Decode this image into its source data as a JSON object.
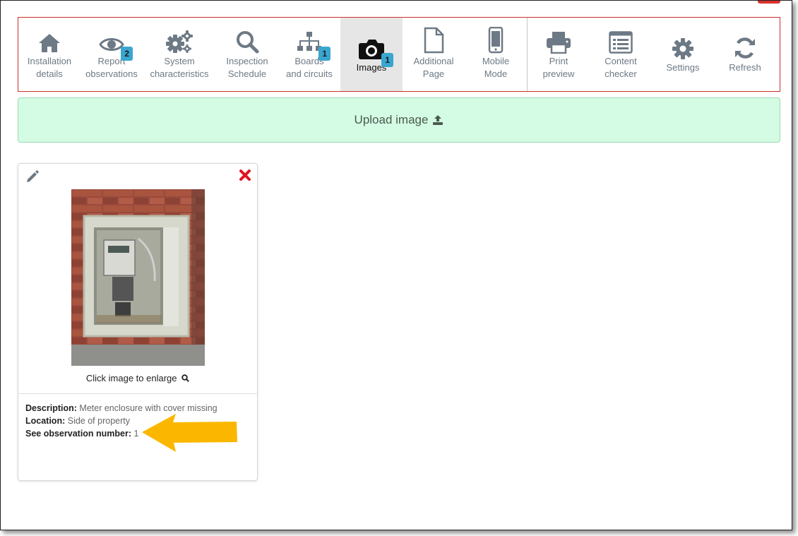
{
  "toolbar": {
    "items": [
      {
        "label": "Installation\ndetails",
        "icon": "home-icon"
      },
      {
        "label": "Report\nobservations",
        "icon": "eye-icon",
        "badge": "2"
      },
      {
        "label": "System\ncharacteristics",
        "icon": "cogs-icon"
      },
      {
        "label": "Inspection\nSchedule",
        "icon": "search-icon"
      },
      {
        "label": "Boards\nand circuits",
        "icon": "sitemap-icon",
        "badge": "1"
      },
      {
        "label": "Images",
        "icon": "camera-icon",
        "badge": "1",
        "active": true
      },
      {
        "label": "Additional\nPage",
        "icon": "file-icon"
      },
      {
        "label": "Mobile\nMode",
        "icon": "mobile-icon"
      },
      {
        "label": "Print\npreview",
        "icon": "print-icon"
      },
      {
        "label": "Content\nchecker",
        "icon": "list-alt-icon"
      },
      {
        "label": "Settings",
        "icon": "gear-icon"
      },
      {
        "label": "Refresh",
        "icon": "refresh-icon"
      }
    ]
  },
  "upload": {
    "label": "Upload image"
  },
  "image_card": {
    "enlarge_label": "Click image to enlarge",
    "description_label": "Description:",
    "description_value": "Meter enclosure with cover missing",
    "location_label": "Location:",
    "location_value": "Side of property",
    "observation_label": "See observation number:",
    "observation_value": "1"
  },
  "colors": {
    "toolbar_border": "#c9302c",
    "icon": "#6d7985",
    "badge": "#3aa6d0",
    "upload_bg": "#d4fbe3",
    "delete": "#e0141e",
    "annotation_arrow": "#fbb700"
  }
}
